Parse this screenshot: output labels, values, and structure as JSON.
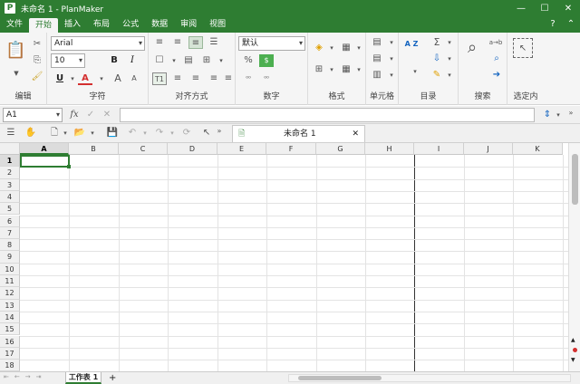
{
  "window": {
    "title": "未命名 1 - PlanMaker",
    "app_icon": "P",
    "min": "—",
    "max": "☐",
    "close": "✕"
  },
  "menu": {
    "tabs": [
      {
        "label": "文件"
      },
      {
        "label": "开始"
      },
      {
        "label": "插入"
      },
      {
        "label": "布局"
      },
      {
        "label": "公式"
      },
      {
        "label": "数据"
      },
      {
        "label": "审阅"
      },
      {
        "label": "视图"
      }
    ],
    "active": "开始",
    "help": "?",
    "collapse": "⌃"
  },
  "ribbon": {
    "groups": {
      "edit": "编辑",
      "font": "字符",
      "align": "对齐方式",
      "number": "数字",
      "format": "格式",
      "cells": "单元格",
      "directory": "目录",
      "search": "搜索",
      "select": "选定内"
    },
    "font_name": "Arial",
    "font_size": "10",
    "number_format": "默认",
    "bold": "B",
    "italic": "I",
    "underline": "U",
    "font_color": "A",
    "grow": "A",
    "shrink": "A",
    "percent": "%",
    "decimal_inc": "⁰⁰",
    "decimal_dec": "⁰⁰",
    "replace_label": "a→b",
    "sum": "Σ",
    "sort": "A Z",
    "t1": "T1"
  },
  "formula_bar": {
    "cell_ref": "A1",
    "fx": "fx",
    "cancel": "✓",
    "reject": "✕",
    "formula": ""
  },
  "toolbar2": {
    "doc_tab": "未命名 1",
    "doc_close": "✕",
    "more": "»"
  },
  "grid": {
    "columns": [
      "A",
      "B",
      "C",
      "D",
      "E",
      "F",
      "G",
      "H",
      "I",
      "J",
      "K"
    ],
    "rows": [
      "1",
      "2",
      "3",
      "4",
      "5",
      "6",
      "7",
      "8",
      "9",
      "10",
      "11",
      "12",
      "13",
      "14",
      "15",
      "16",
      "17",
      "18"
    ],
    "selected_cell": "A1"
  },
  "status": {
    "sheet_tab": "工作表 1",
    "add_sheet": "+"
  },
  "colors": {
    "accent": "#2e7d32",
    "ribbon_bg": "#f5f5f5"
  }
}
